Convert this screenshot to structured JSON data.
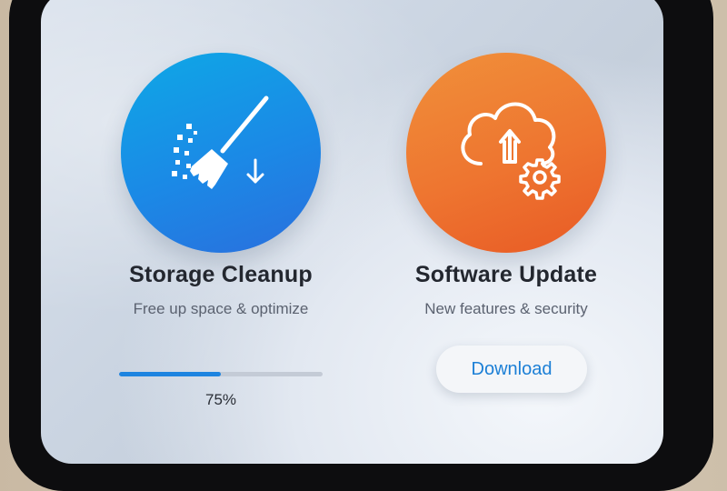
{
  "cards": [
    {
      "id": "storage",
      "title": "Storage Cleanup",
      "subtitle": "Free up space & optimize",
      "icon": "broom-icon",
      "accent": "#1b89e6",
      "progress": {
        "value": 0.5,
        "label": "75%"
      }
    },
    {
      "id": "update",
      "title": "Software Update",
      "subtitle": "New features & security",
      "icon": "cloud-upload-gear-icon",
      "accent": "#ee7530",
      "button": {
        "label": "Download"
      }
    }
  ]
}
